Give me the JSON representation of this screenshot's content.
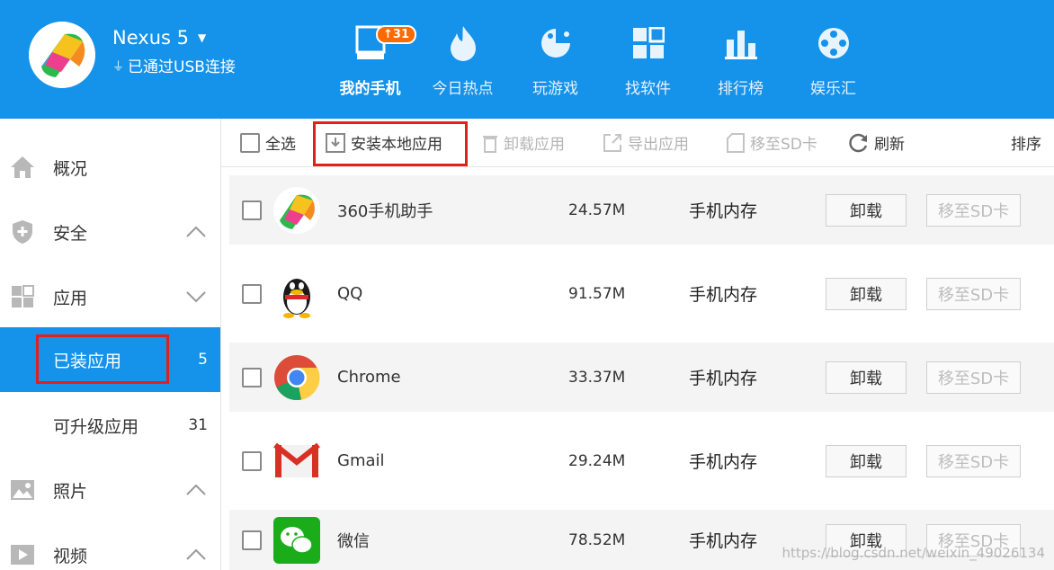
{
  "header": {
    "device_name": "Nexus 5",
    "connection": "已通过USB连接",
    "nav": [
      {
        "label": "我的手机",
        "icon": "phone-icon",
        "active": true,
        "badge": "31"
      },
      {
        "label": "今日热点",
        "icon": "flame-icon"
      },
      {
        "label": "玩游戏",
        "icon": "game-icon"
      },
      {
        "label": "找软件",
        "icon": "apps-grid-icon"
      },
      {
        "label": "排行榜",
        "icon": "bar-chart-icon"
      },
      {
        "label": "娱乐汇",
        "icon": "film-reel-icon"
      }
    ]
  },
  "sidebar": {
    "items": [
      {
        "label": "概况",
        "icon": "home-icon"
      },
      {
        "label": "安全",
        "icon": "shield-icon",
        "arrow": "up"
      },
      {
        "label": "应用",
        "icon": "apps-icon",
        "arrow": "down"
      },
      {
        "label": "已装应用",
        "count": "5",
        "selected": true
      },
      {
        "label": "可升级应用",
        "count": "31"
      },
      {
        "label": "照片",
        "icon": "photo-icon",
        "arrow": "up"
      },
      {
        "label": "视频",
        "icon": "video-icon",
        "arrow": "up"
      }
    ]
  },
  "toolbar": {
    "select_all": "全选",
    "install_local": "安装本地应用",
    "uninstall": "卸载应用",
    "export": "导出应用",
    "move_sd": "移至SD卡",
    "refresh": "刷新",
    "sort": "排序"
  },
  "apps": [
    {
      "name": "360手机助手",
      "size": "24.57M",
      "location": "手机内存",
      "icon": "360-assistant-icon"
    },
    {
      "name": "QQ",
      "size": "91.57M",
      "location": "手机内存",
      "icon": "qq-icon"
    },
    {
      "name": "Chrome",
      "size": "33.37M",
      "location": "手机内存",
      "icon": "chrome-icon"
    },
    {
      "name": "Gmail",
      "size": "29.24M",
      "location": "手机内存",
      "icon": "gmail-icon"
    },
    {
      "name": "微信",
      "size": "78.52M",
      "location": "手机内存",
      "icon": "wechat-icon"
    }
  ],
  "row_buttons": {
    "uninstall": "卸载",
    "move_sd": "移至SD卡"
  },
  "watermark": "https://blog.csdn.net/weixin_49026134",
  "colors": {
    "brand_blue": "#1592e9",
    "highlight_red": "#e0201a",
    "badge_orange": "#ff6a00"
  }
}
